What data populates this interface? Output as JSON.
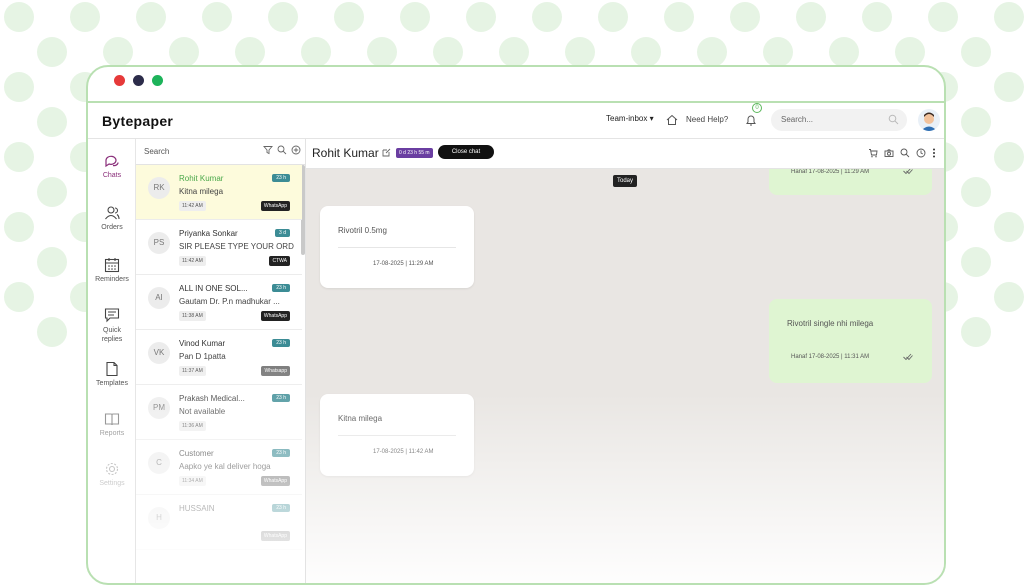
{
  "app": {
    "brand": "Bytepaper"
  },
  "header": {
    "team_label": "Team-inbox ▾",
    "help_label": "Need Help?",
    "notification_count": "0",
    "search_placeholder": "Search..."
  },
  "sidebar": {
    "items": [
      {
        "label": "Chats",
        "icon": "chat-bubbles-icon"
      },
      {
        "label": "Orders",
        "icon": "users-icon"
      },
      {
        "label": "Reminders",
        "icon": "calendar-icon"
      },
      {
        "label": "Quick replies",
        "icon": "quick-reply-icon"
      },
      {
        "label": "Templates",
        "icon": "document-icon"
      },
      {
        "label": "Reports",
        "icon": "book-icon"
      },
      {
        "label": "Settings",
        "icon": "gear-icon"
      }
    ]
  },
  "chatlist": {
    "search_placeholder": "Search",
    "chats": [
      {
        "initials": "RK",
        "name": "Rohit Kumar",
        "message": "Kitna milega",
        "time": "11:42 AM",
        "badge": "23 h",
        "source": "WhatsApp"
      },
      {
        "initials": "PS",
        "name": "Priyanka Sonkar",
        "message": "SIR PLEASE TYPE YOUR ORDE...",
        "time": "11:42 AM",
        "badge": "3 d",
        "source": "CTWA"
      },
      {
        "initials": "AI",
        "name": "ALL IN ONE SOL...",
        "message": "Gautam Dr. P.n madhukar ...",
        "time": "11:38 AM",
        "badge": "23 h",
        "source": "WhatsApp"
      },
      {
        "initials": "VK",
        "name": "Vinod Kumar",
        "message": "Pan D 1patta",
        "time": "11:37 AM",
        "badge": "23 h",
        "source": "Whatsapp"
      },
      {
        "initials": "PM",
        "name": "Prakash Medical...",
        "message": "Not available",
        "time": "11:36 AM",
        "badge": "23 h",
        "source": ""
      },
      {
        "initials": "C",
        "name": "Customer",
        "message": "Aapko ye kal deliver hoga",
        "time": "11:34 AM",
        "badge": "23 h",
        "source": "WhatsApp"
      },
      {
        "initials": "H",
        "name": "HUSSAIN",
        "message": "",
        "time": "",
        "badge": "23 h",
        "source": "WhatsApp"
      }
    ]
  },
  "conversation": {
    "contact_name": "Rohit Kumar",
    "timer": "0 d 23 h 55 m",
    "close_label": "Close chat",
    "date_divider": "Today",
    "messages": [
      {
        "direction": "out",
        "text": "",
        "meta": "Hanaf  17-08-2025 | 11:29 AM"
      },
      {
        "direction": "in",
        "text": "Rivotril 0.5mg",
        "meta": "17-08-2025 | 11:29 AM"
      },
      {
        "direction": "out",
        "text": "Rivotril single nhi milega",
        "meta": "Hanaf  17-08-2025 | 11:31 AM"
      },
      {
        "direction": "in",
        "text": "Kitna milega",
        "meta": "17-08-2025 | 11:42 AM"
      }
    ]
  },
  "colors": {
    "accent_green": "#4aa84a",
    "active_purple": "#8a2e7a",
    "badge_teal": "#3c8c95",
    "outgoing_bubble": "#dff5d2"
  }
}
